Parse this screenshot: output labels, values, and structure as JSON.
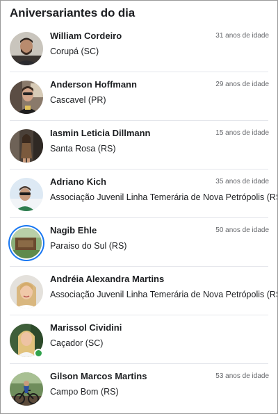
{
  "widget": {
    "title": "Aniversariantes do dia"
  },
  "accent_color": "#1877f2",
  "online_color": "#31a24c",
  "people": [
    {
      "name": "William Cordeiro",
      "location": "Corupá (SC)",
      "age": "31 anos de idade",
      "avatar_icon": "man-portrait-photo"
    },
    {
      "name": "Anderson Hoffmann",
      "location": "Cascavel (PR)",
      "age": "29 anos de idade",
      "avatar_icon": "man-portrait-photo"
    },
    {
      "name": "Iasmin Leticia Dillmann",
      "location": "Santa Rosa (RS)",
      "age": "15 anos de idade",
      "avatar_icon": "woman-portrait-photo"
    },
    {
      "name": "Adriano Kich",
      "location": "Associação Juvenil Linha Temerária de Nova Petrópolis (RS)",
      "age": "35 anos de idade",
      "avatar_icon": "man-sunglasses-photo"
    },
    {
      "name": "Nagib Ehle",
      "location": "Paraiso do Sul (RS)",
      "age": "50 anos de idade",
      "avatar_icon": "landscape-photo",
      "has_story_ring": true
    },
    {
      "name": "Andréia Alexandra Martins",
      "location": "Associação Juvenil Linha Temerária de Nova Petrópolis (RS)",
      "age": "",
      "avatar_icon": "woman-portrait-photo"
    },
    {
      "name": "Marissol Cividini",
      "location": "Caçador (SC)",
      "age": "",
      "avatar_icon": "woman-portrait-photo",
      "online": true
    },
    {
      "name": "Gilson Marcos Martins",
      "location": "Campo Bom (RS)",
      "age": "53 anos de idade",
      "avatar_icon": "cyclist-photo"
    }
  ]
}
